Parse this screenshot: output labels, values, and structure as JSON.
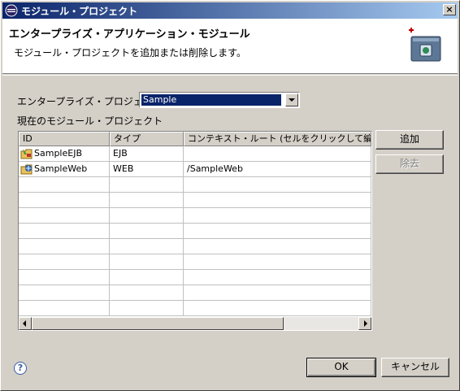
{
  "window": {
    "title": "モジュール・プロジェクト",
    "close_label": "×"
  },
  "banner": {
    "heading": "エンタープライズ・アプリケーション・モジュール",
    "description": "モジュール・プロジェクトを追加または削除します。"
  },
  "form": {
    "project_label": "エンタープライズ・プロジェクト",
    "project_value": "Sample",
    "modules_label": "現在のモジュール・プロジェクト"
  },
  "table": {
    "columns": [
      "ID",
      "タイプ",
      "コンテキスト・ルート (セルをクリックして編集)"
    ],
    "rows": [
      {
        "id": "SampleEJB",
        "type": "EJB",
        "context_root": "",
        "icon": "ejb-project-icon"
      },
      {
        "id": "SampleWeb",
        "type": "WEB",
        "context_root": "/SampleWeb",
        "icon": "web-project-icon"
      }
    ]
  },
  "buttons": {
    "add": "追加",
    "remove": "除去",
    "ok": "OK",
    "cancel": "キャンセル"
  },
  "help": {
    "label": "?"
  },
  "colors": {
    "title_gradient_start": "#0a246a",
    "title_gradient_end": "#a6caf0",
    "selection": "#0a246a",
    "dialog_bg": "#d4d0c8"
  }
}
